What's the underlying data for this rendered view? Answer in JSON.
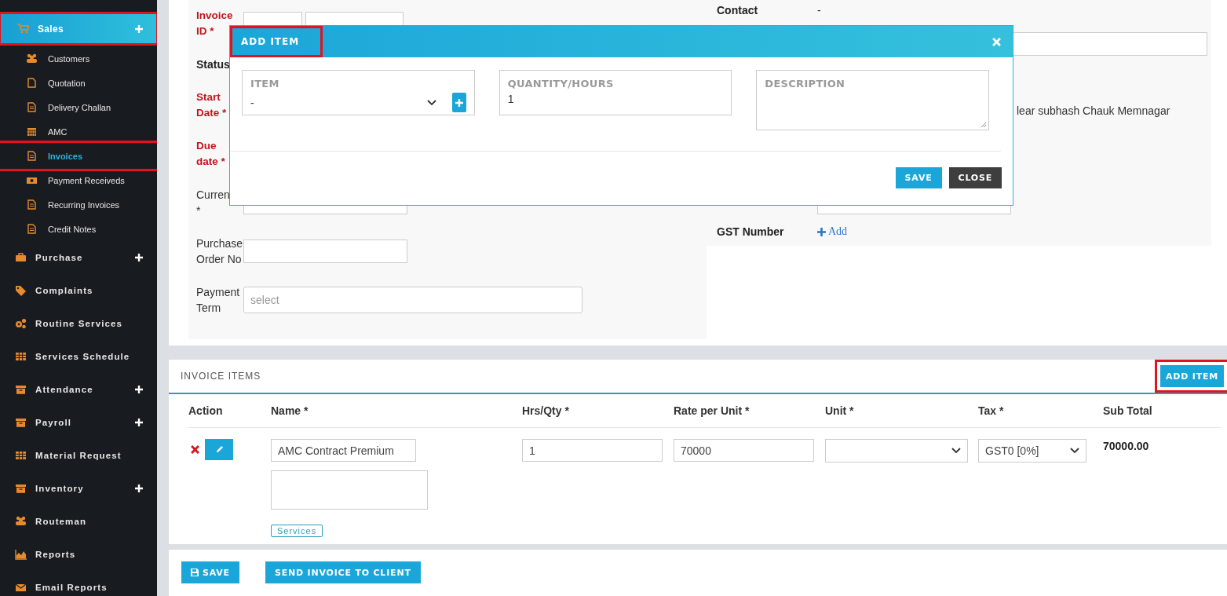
{
  "sidebar": {
    "items": [
      {
        "label": "Sales",
        "expandable": true,
        "selected": true,
        "annotated": true,
        "children": [
          {
            "label": "Customers",
            "selected": false,
            "annotated": false
          },
          {
            "label": "Quotation",
            "selected": false,
            "annotated": false
          },
          {
            "label": "Delivery Challan",
            "selected": false,
            "annotated": false
          },
          {
            "label": "AMC",
            "selected": false,
            "annotated": false
          },
          {
            "label": "Invoices",
            "selected": true,
            "annotated": true
          },
          {
            "label": "Payment Receiveds",
            "selected": false,
            "annotated": false
          },
          {
            "label": "Recurring Invoices",
            "selected": false,
            "annotated": false
          },
          {
            "label": "Credit Notes",
            "selected": false,
            "annotated": false
          }
        ]
      },
      {
        "label": "Purchase",
        "expandable": true,
        "selected": false,
        "annotated": false
      },
      {
        "label": "Complaints",
        "expandable": false,
        "selected": false,
        "annotated": false
      },
      {
        "label": "Routine Services",
        "expandable": false,
        "selected": false,
        "annotated": false
      },
      {
        "label": "Services Schedule",
        "expandable": false,
        "selected": false,
        "annotated": false
      },
      {
        "label": "Attendance",
        "expandable": true,
        "selected": false,
        "annotated": false
      },
      {
        "label": "Payroll",
        "expandable": true,
        "selected": false,
        "annotated": false
      },
      {
        "label": "Material Request",
        "expandable": false,
        "selected": false,
        "annotated": false
      },
      {
        "label": "Inventory",
        "expandable": true,
        "selected": false,
        "annotated": false
      },
      {
        "label": "Routeman",
        "expandable": false,
        "selected": false,
        "annotated": false
      },
      {
        "label": "Reports",
        "expandable": false,
        "selected": false,
        "annotated": false
      },
      {
        "label": "Email Reports",
        "expandable": false,
        "selected": false,
        "annotated": false
      }
    ]
  },
  "invoice_form": {
    "left_fields": [
      {
        "label": "Invoice ID *",
        "required": true,
        "bold": true,
        "kind": "pair"
      },
      {
        "label": "Status",
        "required": false,
        "bold": true,
        "kind": "none"
      },
      {
        "label": "Start Date *",
        "required": true,
        "bold": true,
        "kind": "none"
      },
      {
        "label": "Due date *",
        "required": true,
        "bold": true,
        "kind": "none"
      },
      {
        "label": "Curren",
        "suffix": "*",
        "required": false,
        "bold": false,
        "kind": "input"
      },
      {
        "label": "Purchase Order No",
        "required": false,
        "bold": false,
        "kind": "input"
      },
      {
        "label": "Payment Term",
        "required": false,
        "bold": false,
        "kind": "wide",
        "placeholder": "select"
      }
    ],
    "right_fields": [
      {
        "label": "Contact",
        "kind": "text",
        "value": "-"
      },
      {
        "kind": "input"
      },
      {
        "kind": "text",
        "value": "lear subhash Chauk Memnagar"
      },
      {
        "kind": "select"
      },
      {
        "label": "GST Number",
        "kind": "link",
        "value": "Add"
      }
    ]
  },
  "modal": {
    "title": "ADD ITEM",
    "annotated": true,
    "fields": [
      {
        "label": "ITEM",
        "kind": "select",
        "value": "-"
      },
      {
        "label": "QUANTITY/HOURS",
        "kind": "input",
        "value": "1"
      },
      {
        "label": "DESCRIPTION",
        "kind": "textarea"
      }
    ],
    "buttons": [
      {
        "label": "SAVE",
        "kind": "primary"
      },
      {
        "label": "CLOSE",
        "kind": "dark"
      }
    ]
  },
  "invoice_items": {
    "title": "INVOICE ITEMS",
    "add_button": {
      "label": "ADD ITEM",
      "annotated": true
    },
    "columns": [
      "Action",
      "Name *",
      "Hrs/Qty *",
      "Rate per Unit *",
      "Unit *",
      "Tax *",
      "Sub Total"
    ],
    "rows": [
      {
        "name": "AMC Contract Premium",
        "tag": "Services",
        "qty": "1",
        "rate": "70000",
        "tax": "GST0 [0%]",
        "subtotal": "70000.00"
      }
    ]
  },
  "footer_buttons": [
    {
      "label": "SAVE"
    },
    {
      "label": "SEND INVOICE TO CLIENT"
    }
  ]
}
